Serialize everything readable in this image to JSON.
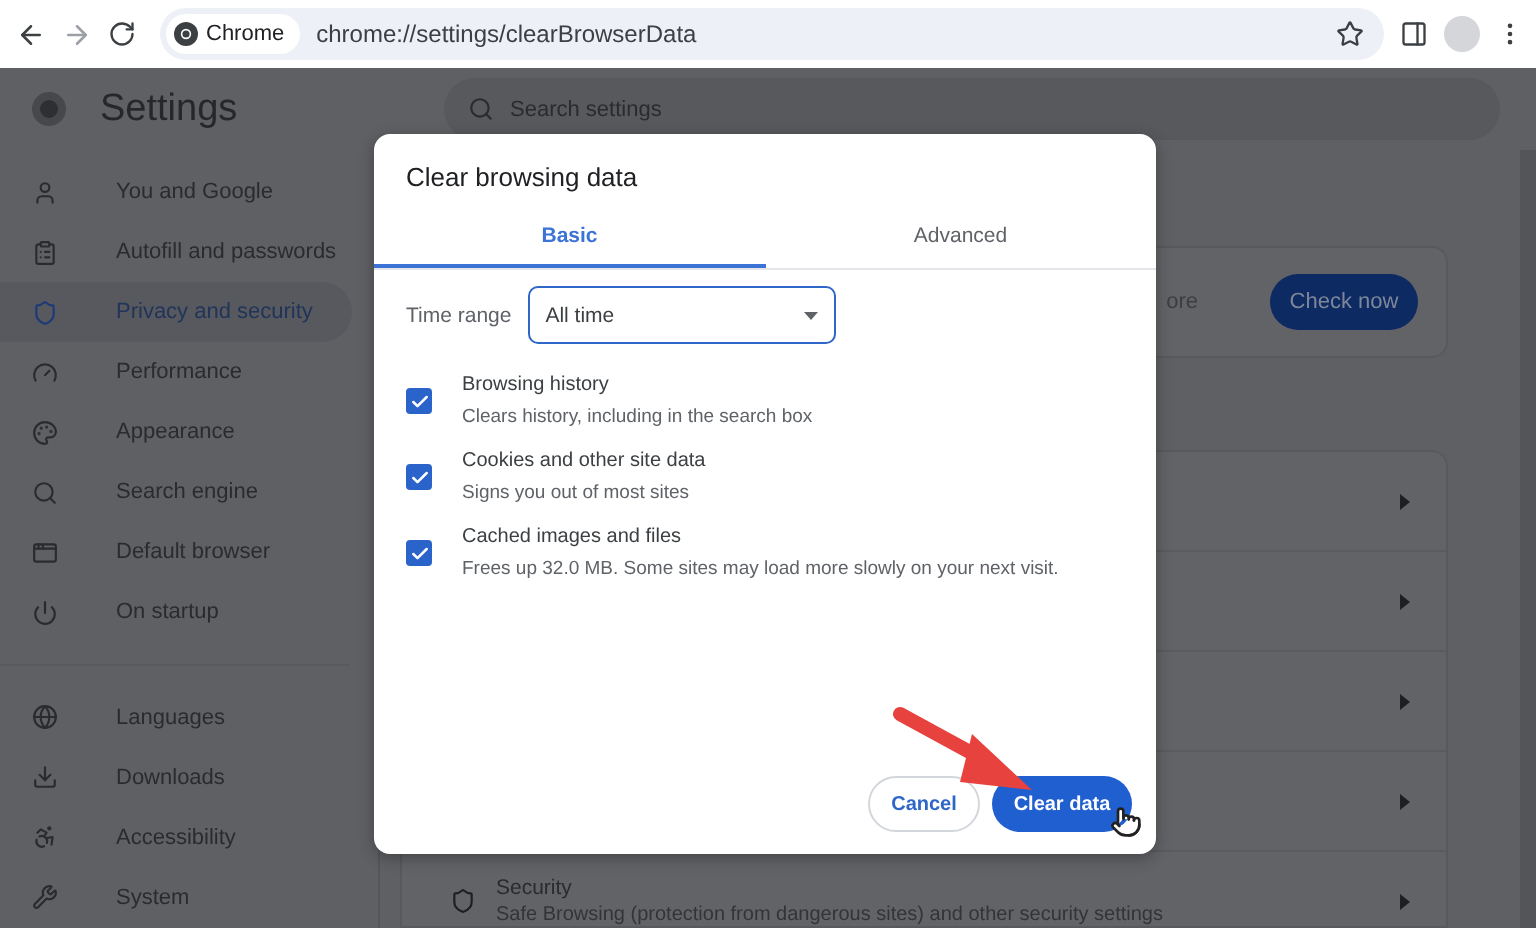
{
  "toolbar": {
    "chip": "Chrome",
    "url": "chrome://settings/clearBrowserData"
  },
  "header": {
    "title": "Settings",
    "search_placeholder": "Search settings"
  },
  "sidebar": {
    "groups": [
      [
        {
          "label": "You and Google",
          "selected": false
        },
        {
          "label": "Autofill and passwords",
          "selected": false
        },
        {
          "label": "Privacy and security",
          "selected": true
        },
        {
          "label": "Performance",
          "selected": false
        },
        {
          "label": "Appearance",
          "selected": false
        },
        {
          "label": "Search engine",
          "selected": false
        },
        {
          "label": "Default browser",
          "selected": false
        },
        {
          "label": "On startup",
          "selected": false
        }
      ],
      [
        {
          "label": "Languages",
          "selected": false
        },
        {
          "label": "Downloads",
          "selected": false
        },
        {
          "label": "Accessibility",
          "selected": false
        },
        {
          "label": "System",
          "selected": false
        }
      ]
    ]
  },
  "safety_check": {
    "text": "ore",
    "button": "Check now"
  },
  "privacy_list": {
    "rows": [
      {
        "title": "Security",
        "description": "Safe Browsing (protection from dangerous sites) and other security settings"
      }
    ]
  },
  "dialog": {
    "title": "Clear browsing data",
    "tabs": [
      {
        "label": "Basic",
        "selected": true
      },
      {
        "label": "Advanced",
        "selected": false
      }
    ],
    "time_range": {
      "label": "Time range",
      "value": "All time"
    },
    "options": [
      {
        "title": "Browsing history",
        "description": "Clears history, including in the search box",
        "checked": true
      },
      {
        "title": "Cookies and other site data",
        "description": "Signs you out of most sites",
        "checked": true
      },
      {
        "title": "Cached images and files",
        "description": "Frees up 32.0 MB. Some sites may load more slowly on your next visit.",
        "checked": true
      }
    ],
    "buttons": {
      "cancel": "Cancel",
      "confirm": "Clear data"
    }
  }
}
